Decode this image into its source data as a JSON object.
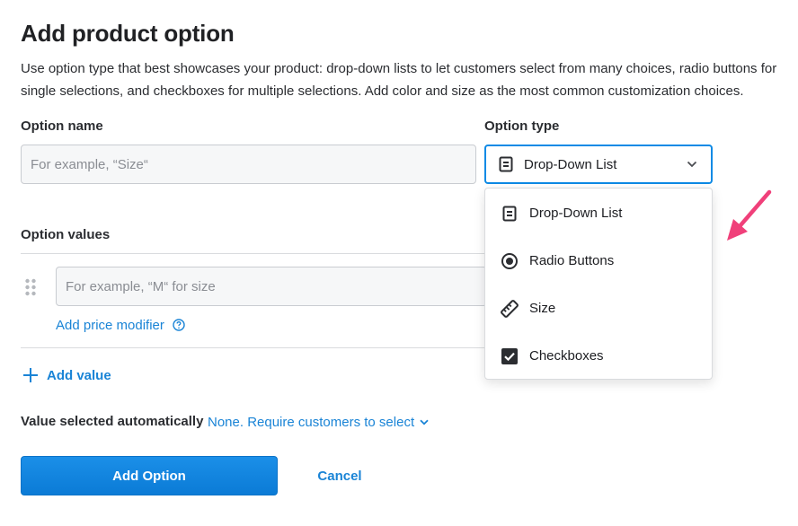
{
  "page": {
    "title": "Add product option",
    "description": "Use option type that best showcases your product: drop-down lists to let customers select from many choices, radio buttons for single selections, and checkboxes for multiple selections. Add color and size as the most common customization choices."
  },
  "option_name": {
    "label": "Option name",
    "placeholder": "For example, “Size“",
    "value": ""
  },
  "option_type": {
    "label": "Option type",
    "selected": "Drop-Down List",
    "selected_icon": "list-icon",
    "items": [
      {
        "label": "Drop-Down List",
        "icon": "list-icon"
      },
      {
        "label": "Radio Buttons",
        "icon": "radio-icon"
      },
      {
        "label": "Size",
        "icon": "ruler-icon"
      },
      {
        "label": "Checkboxes",
        "icon": "checkbox-icon"
      }
    ]
  },
  "option_values": {
    "label": "Option values",
    "value_placeholder": "For example, “M“ for size",
    "add_price_modifier": "Add price modifier",
    "add_value": "Add value"
  },
  "auto_select": {
    "label": "Value selected automatically",
    "value": "None. Require customers to select"
  },
  "actions": {
    "primary": "Add Option",
    "cancel": "Cancel"
  },
  "colors": {
    "accent": "#1a84d6",
    "primary_button": "#0d8ae5",
    "annotation_arrow": "#f0407a"
  }
}
